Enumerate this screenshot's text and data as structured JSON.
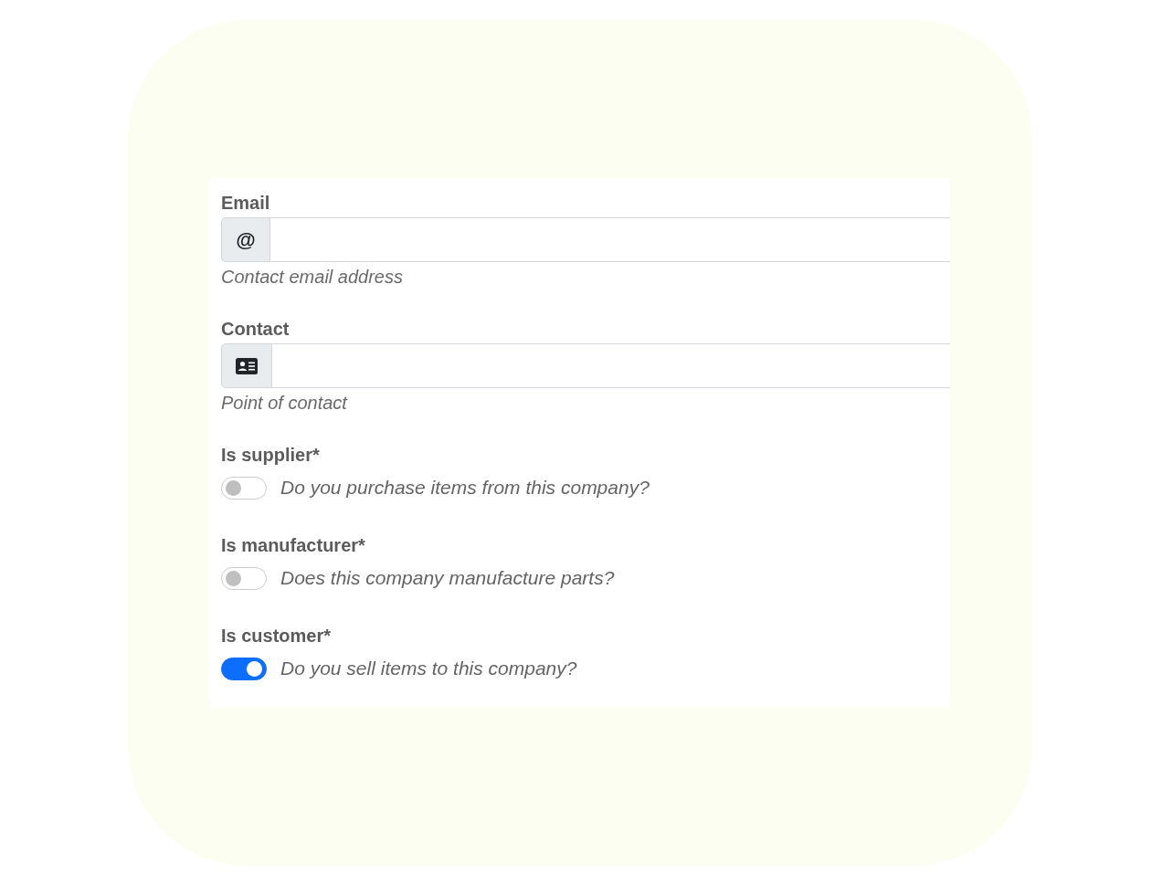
{
  "fields": [
    {
      "kind": "text_prefix",
      "label": "Email",
      "prefix": "@",
      "help": "Contact email address"
    },
    {
      "kind": "icon_prefix",
      "label": "Contact",
      "help": "Point of contact"
    }
  ],
  "switches": [
    {
      "label": "Is supplier*",
      "description": "Do you purchase items from this company?",
      "on": false
    },
    {
      "label": "Is manufacturer*",
      "description": "Does this company manufacture parts?",
      "on": false
    },
    {
      "label": "Is customer*",
      "description": "Do you sell items to this company?",
      "on": true
    }
  ]
}
